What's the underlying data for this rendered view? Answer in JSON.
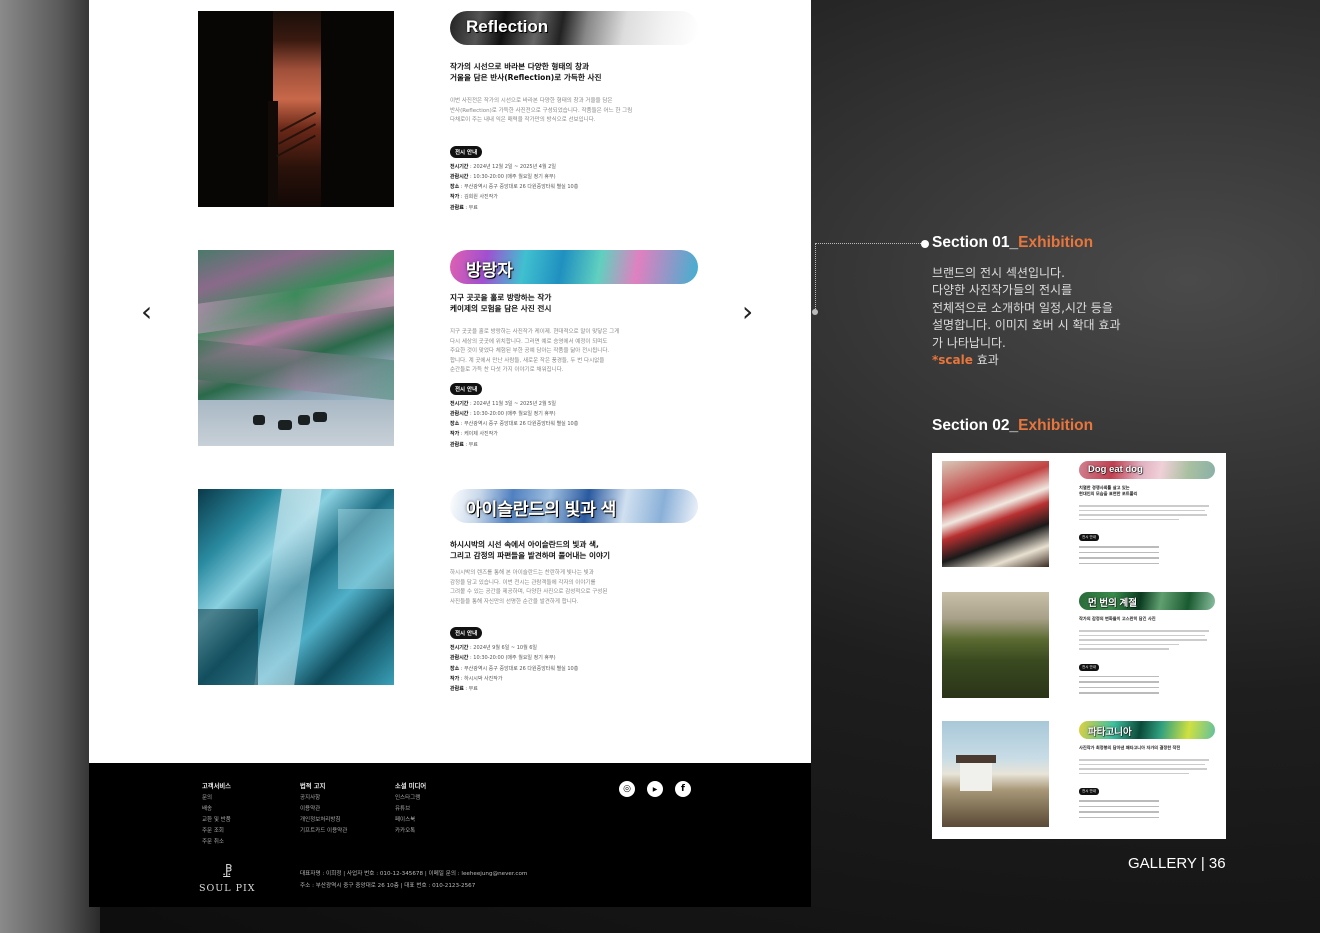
{
  "exhibitions": [
    {
      "title": "Reflection",
      "subtitle_1": "작가의 시선으로 바라본 다양한 형태의 창과",
      "subtitle_2": "거울을 담은 반사(Reflection)로 가득한 사진",
      "desc_1": "이번 사진전은 작가의 시선으로 바라본 다양한 형태의 창과 거울을 담은",
      "desc_2": "반사(Reflection)로 가득한 사진전으로 구성되었습니다. 작품들은 어느 한 그림",
      "desc_3": "다채로이 주는 내내 익은 매력을 작가만의 방식으로 선보입니다.",
      "badge": "전시 안내",
      "period_label": "전시기간",
      "period": " : 2024년 12월 2일 ~ 2025년 4월 2일",
      "hours_label": "관람시간",
      "hours": " : 10:30-20:00 (매주 월요일 정기 휴무)",
      "place_label": "장소",
      "place": " : 부산광역시 중구 중앙대로 26 다원중앙타워 별실 10층",
      "artist_label": "작가",
      "artist": " : 김희원 사진작가",
      "fee_label": "관람료",
      "fee": " : 무료"
    },
    {
      "title": "방랑자",
      "subtitle_1": "지구 곳곳을 홀로 방랑하는 작가",
      "subtitle_2": "케이제의 모험을 담은 사진 전시",
      "desc_1": "지구 곳곳을 홀로 방랑하는 사진작가 케이제. 현대적으로 말이 맞닿은 그게",
      "desc_2": "다시 세상의 곳곳에 위치합니다. 그러면 예로 승영에서 예정이 되며도",
      "desc_3": "주요한 것이 맞었다 체험된 부한 공예 담아는 작품을 닮아 전시됩니다.",
      "desc_4": "합니다. 계 곳에서 만난 사람들, 새로운 작은 풍경들, 두 번 다시없을",
      "desc_5": "순간들로 가득 찬 다섯 가지 이야기로 채워집니다.",
      "badge": "전시 안내",
      "period_label": "전시기간",
      "period": " : 2024년 11월 3일 ~ 2025년 2월 5일",
      "hours_label": "관람시간",
      "hours": " : 10:30-20:00 (매주 월요일 정기 휴무)",
      "place_label": "장소",
      "place": " : 부산광역시 중구 중앙대로 26 다원중앙타워 별실 10층",
      "artist_label": "작가",
      "artist": " : 케이제 사진작가",
      "fee_label": "관람료",
      "fee": " : 무료"
    },
    {
      "title": "아이슬란드의 빛과 색",
      "subtitle_1": "하시시박의 시선 속에서 아이슬란드의 빛과 색,",
      "subtitle_2": "그리고 감정의 파편들을 발견하며 풀어내는 이야기",
      "desc_1": "하시시박의 렌즈를 통해 본 아이슬란드는 찬란하게 빛나는 빛과",
      "desc_2": "감정을 담고 있습니다. 이번 전시는 관람객들에 각자의 이야기를",
      "desc_3": "그려볼 수 있는 공간을 제공하며, 다양한 사진으로 감성적으로 구성된",
      "desc_4": "사진들을 통해 자신만의 선명한 순간을 발견하게 합니다.",
      "badge": "전시 안내",
      "period_label": "전시기간",
      "period": " : 2024년 9월 6일 ~ 10월 6일",
      "hours_label": "관람시간",
      "hours": " : 10:30-20:00 (매주 월요일 정기 휴무)",
      "place_label": "장소",
      "place": " : 부산광역시 중구 중앙대로 26 다원중앙타워 별실 10층",
      "artist_label": "작가",
      "artist": " : 하시시박 사진작가",
      "fee_label": "관람료",
      "fee": " : 무료"
    }
  ],
  "nav": {
    "prev": "‹",
    "next": "›"
  },
  "footer": {
    "col1": {
      "heading": "고객서비스",
      "items": [
        "문의",
        "배송",
        "교환 및 반품",
        "주문 조회",
        "주문 취소"
      ]
    },
    "col2": {
      "heading": "법적 고지",
      "items": [
        "공지사항",
        "이용약관",
        "개인정보처리방침",
        "기프트카드 이용약관"
      ]
    },
    "col3": {
      "heading": "소셜 미디어",
      "items": [
        "인스타그램",
        "유튜브",
        "페이스북",
        "카카오톡"
      ]
    },
    "social": {
      "instagram": "◎",
      "youtube": "▶",
      "facebook": "f"
    },
    "logo_mark": "ꗗ",
    "logo_text": "SOUL PIX",
    "info_1": "대표자명 : 이희정  |  사업자 번호 : 010-12-345678  |  이메일 문의 : leeheejung@never.com",
    "info_2": "주소 : 부산광역시 중구 중앙대로 26 10층  |  대표 번호 : 010-2123-2567"
  },
  "annotation": {
    "sec1_prefix": "Section 01_",
    "sec1_accent": "Exhibition",
    "desc_1": "브랜드의 전시 섹션입니다.",
    "desc_2": "다양한 사진작가들의 전시를",
    "desc_3": "전체적으로 소개하며 일정,시간 등을",
    "desc_4": "설명합니다. 이미지 호버 시 확대 효과",
    "desc_5": "가 나타납니다.",
    "desc_6_accent": "*scale",
    "desc_6_rest": " 효과",
    "sec2_prefix": "Section 02_",
    "sec2_accent": "Exhibition"
  },
  "preview": [
    {
      "title": "Dog eat dog",
      "subtitle_1": "치열한 경쟁사회를 살고 있는",
      "subtitle_2": "현대인의 모습을 표현한 포트폴리",
      "badge": "전시 안내"
    },
    {
      "title": "먼 번의 계절",
      "subtitle_1": "작가의 감정의 변화들이 고스란히 담긴 사진",
      "subtitle_2": "",
      "badge": "전시 안내"
    },
    {
      "title": "파타고니아",
      "subtitle_1": "사진작가 최정봉의 담아낸 패타고니아 자가의 결정한 작전",
      "subtitle_2": "",
      "badge": "전시 안내"
    }
  ],
  "page_label": "GALLERY | 36"
}
